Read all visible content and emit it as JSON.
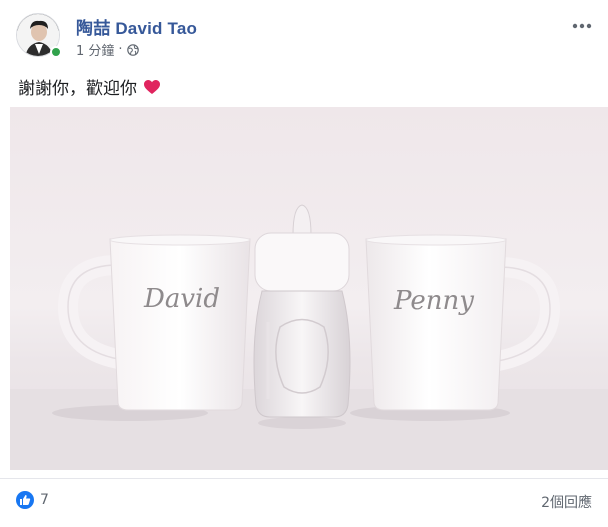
{
  "post": {
    "author": "陶喆 David Tao",
    "time": "1 分鐘",
    "separator": "·",
    "privacy_icon": "globe-icon",
    "text": "謝謝你，歡迎你",
    "emoji": "heart-icon",
    "more_icon": "more-options-icon"
  },
  "photo": {
    "mug_left_label": "David",
    "mug_right_label": "Penny"
  },
  "footer": {
    "reaction_icon": "like-icon",
    "reaction_count": "7",
    "comments_label": "2個回應"
  },
  "colors": {
    "author": "#365899",
    "like": "#1877f2",
    "heart": "#e0245e",
    "online": "#31a24c"
  }
}
